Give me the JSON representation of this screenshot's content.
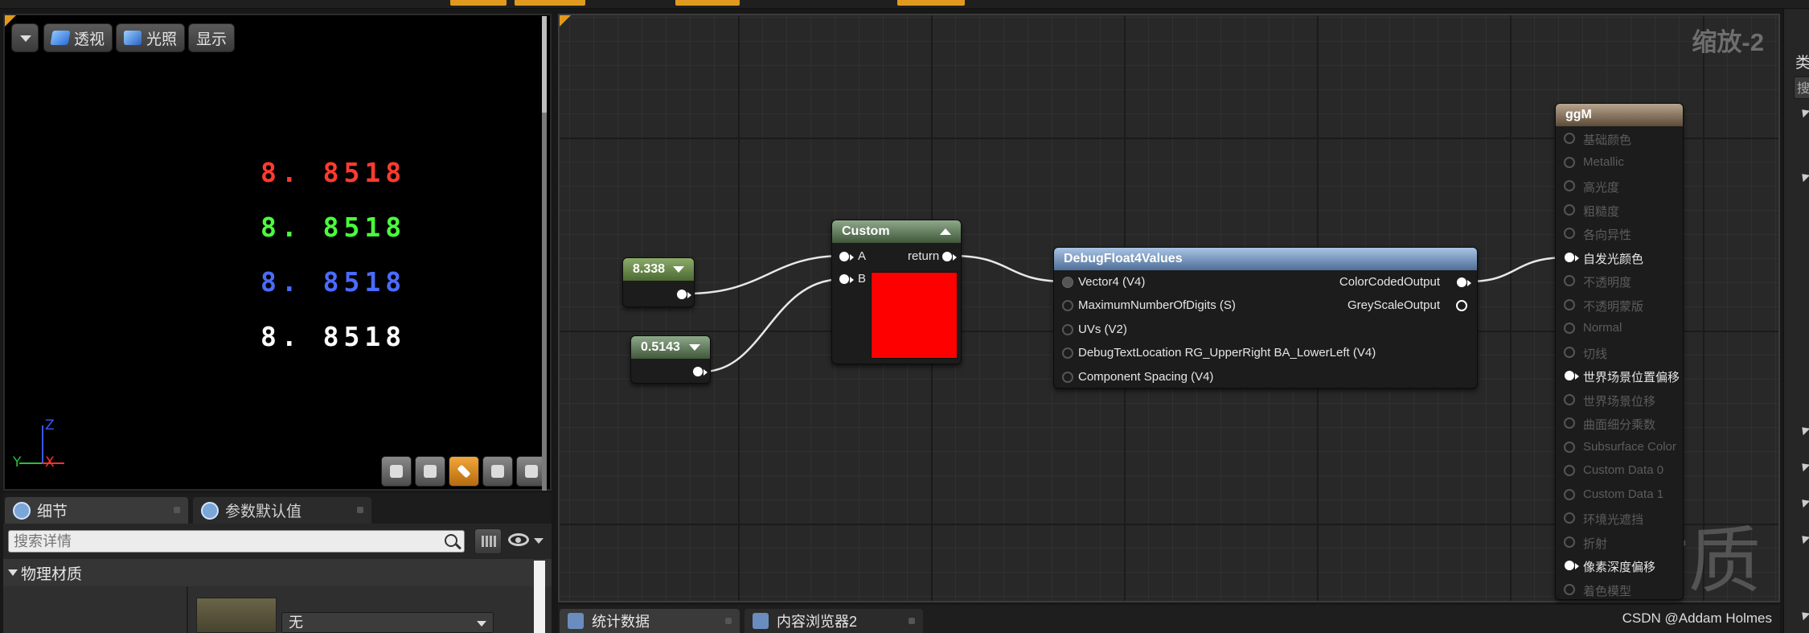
{
  "colors": {
    "accent_orange": "#e09a1f",
    "debug_red": "#ff3b2f",
    "debug_green": "#49ff3c",
    "debug_blue": "#4a6bff",
    "debug_white": "#ffffff",
    "custom_swatch": "#ff0000"
  },
  "viewport": {
    "buttons": {
      "perspective": "透视",
      "lit": "光照",
      "show": "显示"
    },
    "debug_values": [
      "8. 8518",
      "8. 8518",
      "8. 8518",
      "8. 8518"
    ],
    "axis": {
      "z": "Z",
      "y": "Y",
      "x": "X"
    }
  },
  "details_panel": {
    "tabs": {
      "details": "细节",
      "param_defaults": "参数默认值"
    },
    "search_placeholder": "搜索详情",
    "category": "物理材质",
    "dropdown_value": "无"
  },
  "graph": {
    "zoom_label": "缩放-2",
    "watermark": "材质",
    "const_nodes": {
      "first": "8.338",
      "second": "0.5143"
    },
    "custom_node": {
      "title": "Custom",
      "inputs": [
        "A",
        "B"
      ],
      "output": "return"
    },
    "debug_node": {
      "title": "DebugFloat4Values",
      "inputs": [
        "Vector4 (V4)",
        "MaximumNumberOfDigits (S)",
        "UVs (V2)",
        "DebugTextLocation RG_UpperRight BA_LowerLeft (V4)",
        "Component Spacing (V4)"
      ],
      "outputs": [
        "ColorCodedOutput",
        "GreyScaleOutput"
      ]
    },
    "material_node": {
      "title": "ggM",
      "inputs": [
        {
          "label": "基础颜色",
          "active": false
        },
        {
          "label": "Metallic",
          "active": false
        },
        {
          "label": "高光度",
          "active": false
        },
        {
          "label": "粗糙度",
          "active": false
        },
        {
          "label": "各向异性",
          "active": false
        },
        {
          "label": "自发光颜色",
          "active": true
        },
        {
          "label": "不透明度",
          "active": false
        },
        {
          "label": "不透明蒙版",
          "active": false
        },
        {
          "label": "Normal",
          "active": false
        },
        {
          "label": "切线",
          "active": false
        },
        {
          "label": "世界场景位置偏移",
          "active": true
        },
        {
          "label": "世界场景位移",
          "active": false
        },
        {
          "label": "曲面细分乘数",
          "active": false
        },
        {
          "label": "Subsurface Color",
          "active": false
        },
        {
          "label": "Custom Data 0",
          "active": false
        },
        {
          "label": "Custom Data 1",
          "active": false
        },
        {
          "label": "环境光遮挡",
          "active": false
        },
        {
          "label": "折射",
          "active": false
        },
        {
          "label": "像素深度偏移",
          "active": true
        },
        {
          "label": "着色模型",
          "active": false
        }
      ]
    }
  },
  "bottom_tabs": {
    "stats": "统计数据",
    "content_browser": "内容浏览器2"
  },
  "credit": "CSDN @Addam Holmes",
  "right_panel": {
    "label": "类",
    "box_text": "搜"
  }
}
